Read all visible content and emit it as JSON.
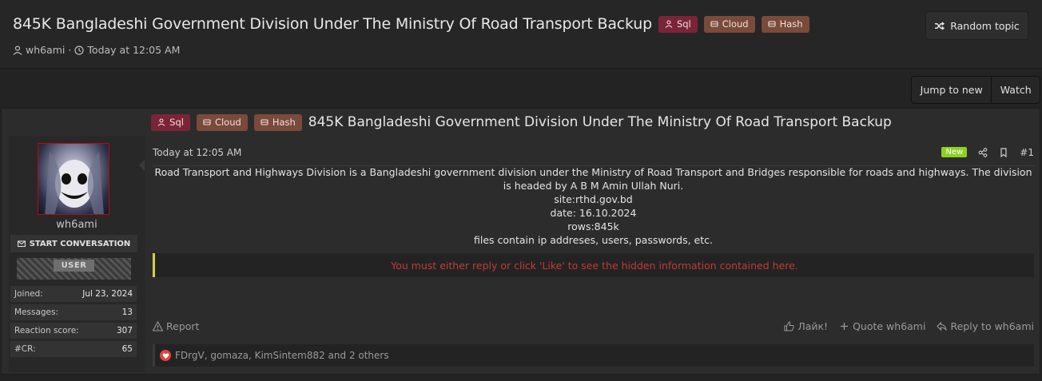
{
  "thread": {
    "title": "845K Bangladeshi Government Division Under The Ministry Of Road Transport Backup",
    "tags": [
      "Sql",
      "Cloud",
      "Hash"
    ],
    "author": "wh6ami",
    "separator": "·",
    "time": "Today at 12:05 AM"
  },
  "header_buttons": {
    "random_topic": "Random topic",
    "jump_to_new": "Jump to new",
    "watch": "Watch"
  },
  "post": {
    "date": "Today at 12:05 AM",
    "new_badge": "New",
    "number": "#1",
    "lines": [
      "Road Transport and Highways Division is a Bangladeshi government division under the Ministry of Road Transport and Bridges responsible for roads and highways. The division is headed by A B M Amin Ullah Nuri.",
      "site:rthd.gov.bd",
      "date: 16.10.2024",
      "rows:845k",
      "files contain ip addreses, users, passwords, etc."
    ],
    "hidden_notice": "You must either reply or click 'Like' to see the hidden information contained here.",
    "report": "Report",
    "like": "Лайк!",
    "quote": "Quote wh6ami",
    "reply": "Reply to wh6ami",
    "reactions_text": "FDrgV, gomaza, KimSintem882 and 2 others"
  },
  "user": {
    "name": "wh6ami",
    "start_conversation": "START CONVERSATION",
    "banner": "USER",
    "stats": [
      {
        "k": "Joined:",
        "v": "Jul 23, 2024"
      },
      {
        "k": "Messages:",
        "v": "13"
      },
      {
        "k": "Reaction score:",
        "v": "307"
      },
      {
        "k": "#CR:",
        "v": "65"
      }
    ]
  },
  "colors": {
    "tag_sql": "#7a2438",
    "tag_cloud": "#7a4a3a",
    "new_badge": "#8bd122",
    "hidden_text": "#c23a3a",
    "hidden_border": "#d8d03a"
  }
}
